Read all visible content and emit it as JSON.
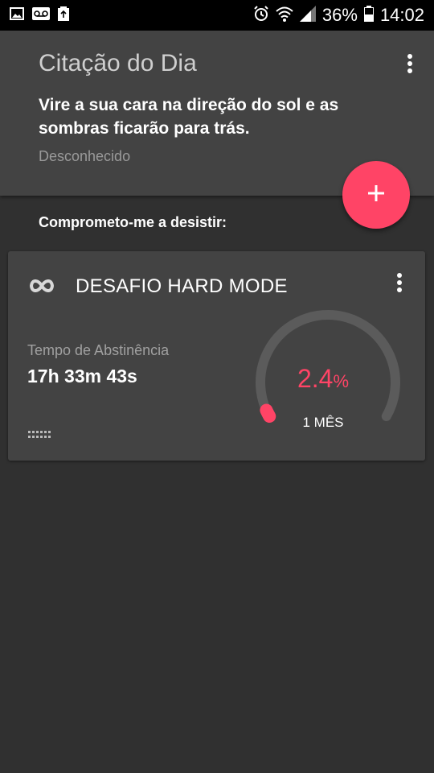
{
  "status_bar": {
    "battery_text": "36%",
    "time": "14:02",
    "icons": [
      "image-icon",
      "voicemail-icon",
      "recycle-icon",
      "alarm-icon",
      "wifi-icon",
      "signal-icon",
      "battery-icon"
    ]
  },
  "quote": {
    "title": "Citação do Dia",
    "text": "Vire a sua cara na direção do sol e as sombras ficarão para trás.",
    "author": "Desconhecido"
  },
  "fab": {
    "icon": "plus-icon"
  },
  "section": {
    "label": "Comprometo-me a desistir:"
  },
  "card": {
    "title": "DESAFIO HARD MODE",
    "icon": "infinity-icon",
    "abstinence_label": "Tempo de Abstinência",
    "abstinence_value": "17h 33m 43s",
    "gauge": {
      "percent_value": "2.4",
      "percent_unit": "%",
      "progress_fraction": 0.024,
      "goal_label": "1 MÊS"
    }
  },
  "colors": {
    "accent": "#ff4466",
    "background": "#303030",
    "surface": "#434343",
    "track": "#5b5b5b"
  }
}
